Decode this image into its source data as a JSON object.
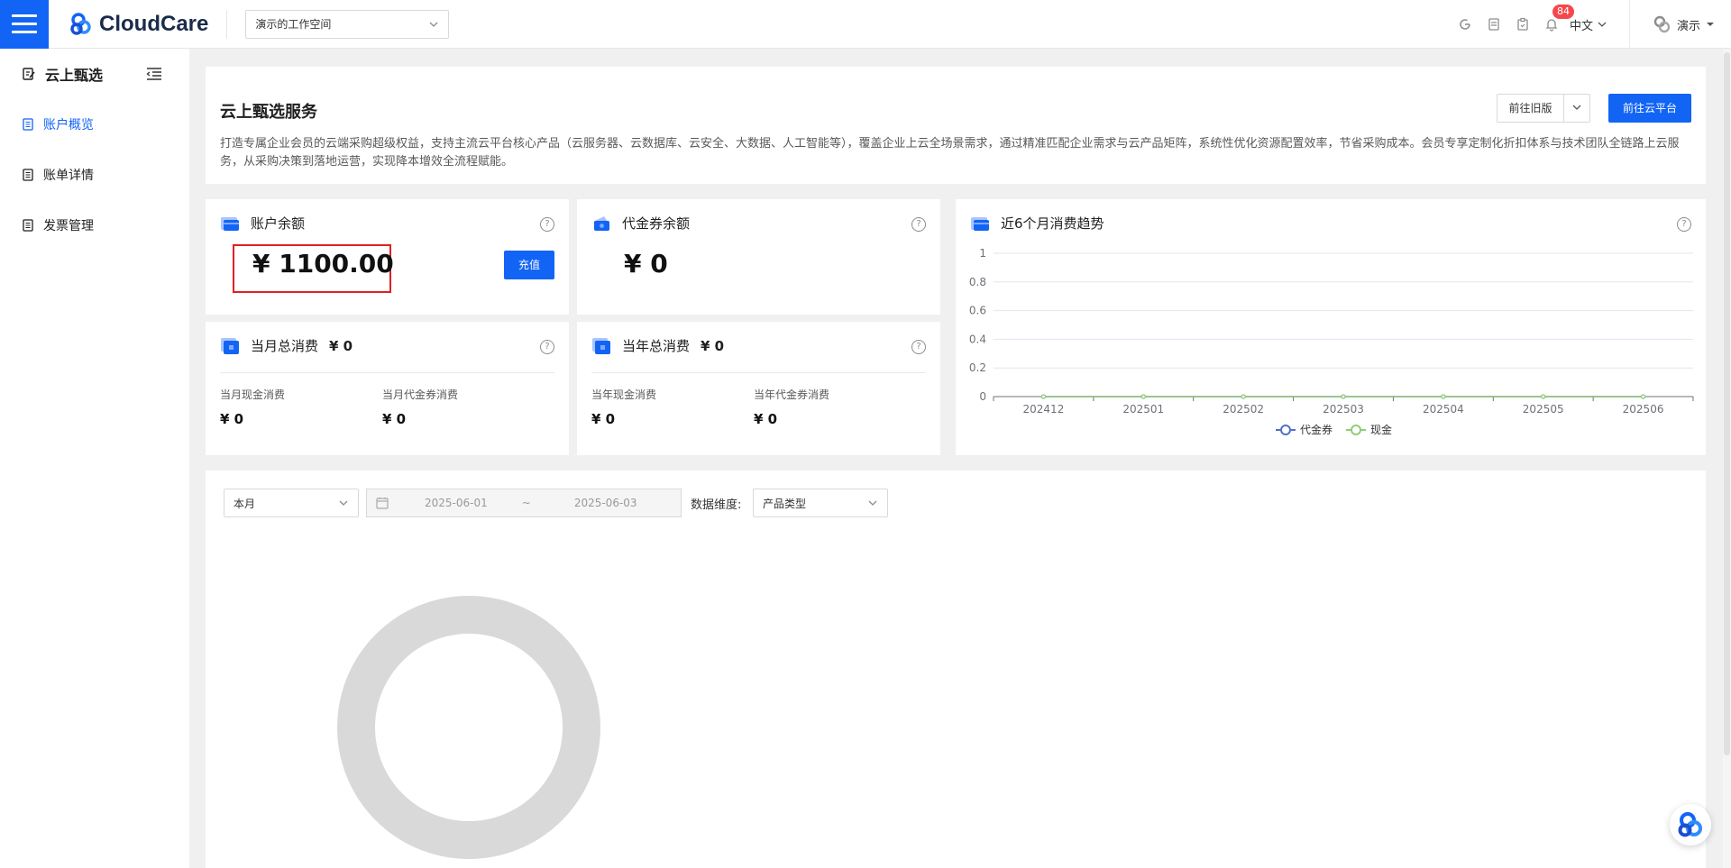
{
  "topbar": {
    "logo_text": "CloudCare",
    "workspace": "演示的工作空间",
    "notification_count": "84",
    "language": "中文",
    "user": "演示"
  },
  "sidebar": {
    "title": "云上甄选",
    "items": [
      {
        "label": "账户概览"
      },
      {
        "label": "账单详情"
      },
      {
        "label": "发票管理"
      }
    ]
  },
  "service": {
    "title": "云上甄选服务",
    "description": "打造专属企业会员的云端采购超级权益，支持主流云平台核心产品（云服务器、云数据库、云安全、大数据、人工智能等），覆盖企业上云全场景需求，通过精准匹配企业需求与云产品矩阵，系统性优化资源配置效率，节省采购成本。会员专享定制化折扣体系与技术团队全链路上云服务，从采购决策到落地运营，实现降本增效全流程赋能。",
    "old_version_label": "前往旧版",
    "cloud_platform_label": "前往云平台"
  },
  "balance": {
    "title": "账户余额",
    "value": "¥ 1100.00",
    "recharge_label": "充值"
  },
  "voucher": {
    "title": "代金券余额",
    "value": "¥ 0"
  },
  "month": {
    "title": "当月总消费",
    "total": "¥ 0",
    "cash_label": "当月现金消费",
    "cash_value": "¥ 0",
    "voucher_label": "当月代金券消费",
    "voucher_value": "¥ 0"
  },
  "year": {
    "title": "当年总消费",
    "total": "¥ 0",
    "cash_label": "当年现金消费",
    "cash_value": "¥ 0",
    "voucher_label": "当年代金券消费",
    "voucher_value": "¥ 0"
  },
  "trend": {
    "title": "近6个月消费趋势"
  },
  "filters": {
    "period": "本月",
    "date_start": "2025-06-01",
    "date_sep": "~",
    "date_end": "2025-06-03",
    "dimension_label": "数据维度:",
    "dimension_value": "产品类型"
  },
  "chart_data": {
    "type": "line",
    "x": [
      "202412",
      "202501",
      "202502",
      "202503",
      "202504",
      "202505",
      "202506"
    ],
    "yticks": [
      "0",
      "0.2",
      "0.4",
      "0.6",
      "0.8",
      "1"
    ],
    "ylim": [
      0,
      1
    ],
    "series": [
      {
        "name": "代金券",
        "values": [
          0,
          0,
          0,
          0,
          0,
          0,
          0
        ],
        "color": "#5470c6"
      },
      {
        "name": "现金",
        "values": [
          0,
          0,
          0,
          0,
          0,
          0,
          0
        ],
        "color": "#91cc75"
      }
    ],
    "legend": "bottom-center",
    "grid": true
  },
  "colors": {
    "accent": "#1264f5",
    "donut": "#d9d9d9"
  }
}
